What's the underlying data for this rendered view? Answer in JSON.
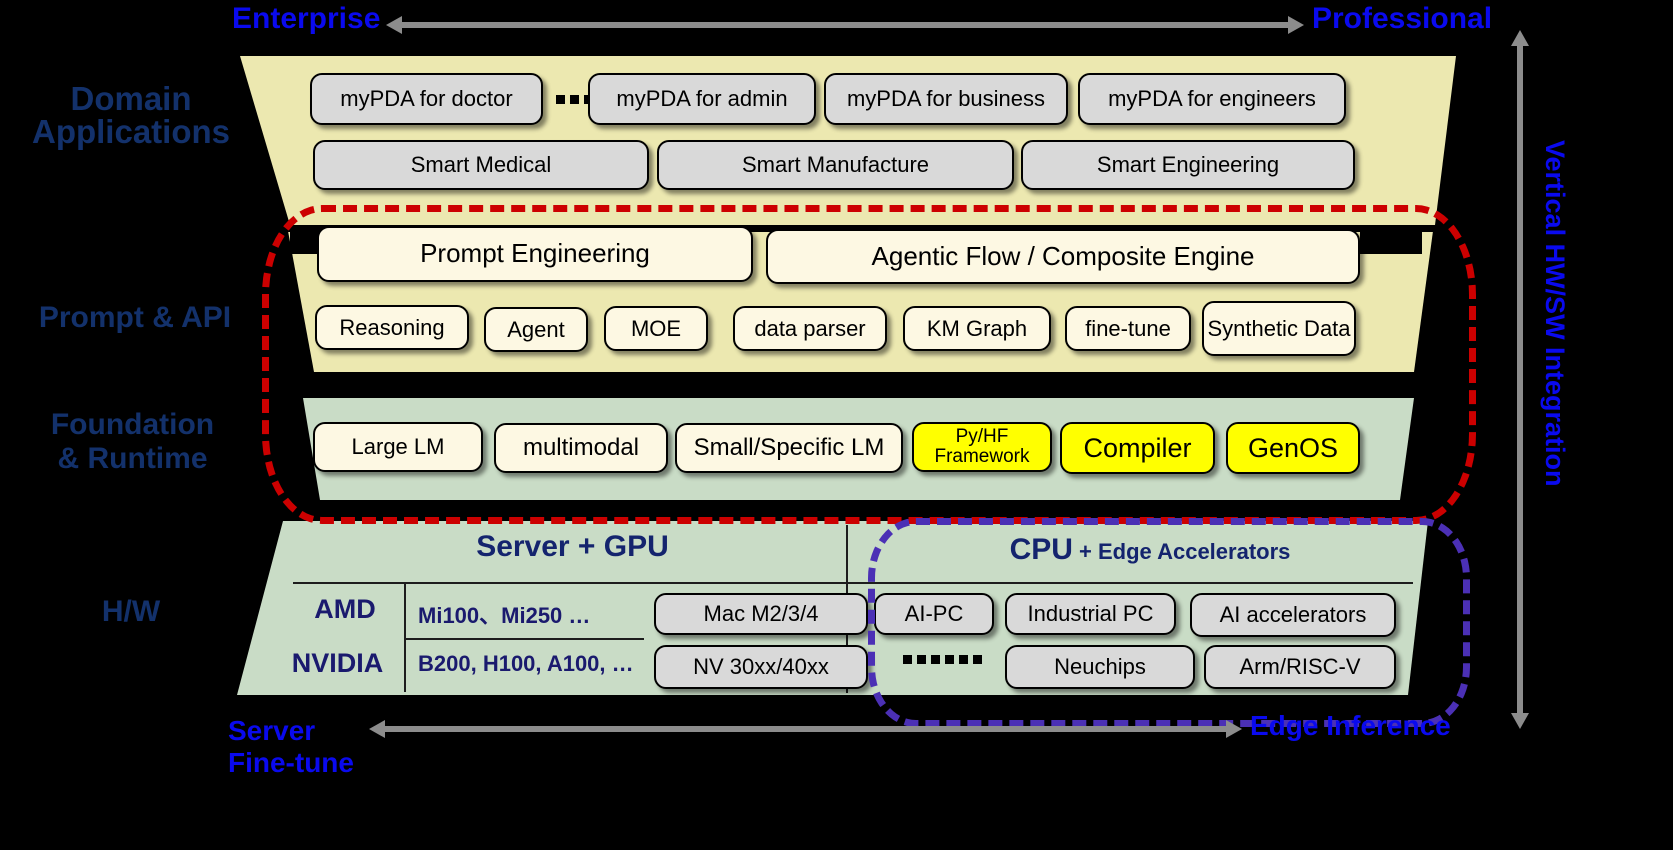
{
  "axes": {
    "top_left_label": "Enterprise",
    "top_right_label": "Professional",
    "bottom_left_label_line1": "Server",
    "bottom_left_label_line2": "Fine-tune",
    "bottom_right_label": "Edge Inference",
    "right_vertical_label": "Vertical HW/SW Integration"
  },
  "tiers": [
    {
      "id": "domain-applications",
      "label_line1": "Domain",
      "label_line2": "Applications"
    },
    {
      "id": "prompt-api",
      "label_line1": "Prompt & API",
      "label_line2": ""
    },
    {
      "id": "foundation-runtime",
      "label_line1": "Foundation",
      "label_line2": "& Runtime"
    },
    {
      "id": "hardware",
      "label_line1": "H/W",
      "label_line2": ""
    }
  ],
  "domain_applications": {
    "apps_row": [
      "myPDA for doctor",
      "myPDA for admin",
      "myPDA for business",
      "myPDA for engineers"
    ],
    "smart_row": [
      "Smart Medical",
      "Smart Manufacture",
      "Smart Engineering"
    ]
  },
  "prompt_api": {
    "engines": [
      "Prompt Engineering",
      "Agentic Flow / Composite Engine"
    ],
    "capabilities": [
      "Reasoning",
      "Agent",
      "MOE",
      "data parser",
      "KM Graph",
      "fine-tune",
      "Synthetic Data"
    ]
  },
  "foundation_runtime": {
    "items": [
      {
        "label": "Large LM",
        "style": "cream"
      },
      {
        "label": "multimodal",
        "style": "cream"
      },
      {
        "label": "Small/Specific LM",
        "style": "cream"
      },
      {
        "label": "Py/HF Framework",
        "style": "yellow"
      },
      {
        "label": "Compiler",
        "style": "yellow"
      },
      {
        "label": "GenOS",
        "style": "yellow"
      }
    ]
  },
  "hardware": {
    "left_header": "Server + GPU",
    "right_header_strong": "CPU",
    "right_header_rest": " + Edge Accelerators",
    "vendor_rows": [
      {
        "vendor": "AMD",
        "parts": "Mi100、Mi250 …",
        "chip": "Mac M2/3/4"
      },
      {
        "vendor": "NVIDIA",
        "parts": "B200, H100, A100, …",
        "chip": "NV 30xx/40xx"
      }
    ],
    "edge_row_1": [
      "AI-PC",
      "Industrial PC",
      "AI accelerators"
    ],
    "edge_row_2": [
      "Neuchips",
      "Arm/RISC-V"
    ]
  },
  "colors": {
    "yellow_band": "#ece8b0",
    "green_band": "#c9dcc6",
    "grey_box": "#d9d9d9",
    "cream_box": "#fdf8e3",
    "yellow_box": "#ffff00",
    "red_dash": "#cc0000",
    "purple_dash": "#4b30b5",
    "label_blue": "#13316b",
    "axis_blue": "#0a0aee",
    "arrow_grey": "#8c8c8c"
  }
}
